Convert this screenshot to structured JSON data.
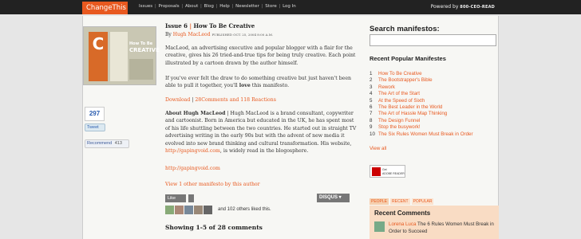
{
  "topbar": {
    "brand": "ChangeThis",
    "nav": [
      "Issues",
      "Proposals",
      "About",
      "Blog",
      "Help",
      "Newsletter",
      "Store",
      "Log In"
    ],
    "powered": "Powered by",
    "powered_brand": "800-CEO-READ"
  },
  "cover": {
    "letter": "C",
    "title_small": "How To Be",
    "title_big": "CREATIVE"
  },
  "social": {
    "count": "297",
    "tweet": "Tweet",
    "recommend": "Recommend",
    "recommend_count": "413"
  },
  "article": {
    "issue_label": "Issue 6",
    "title": "How To Be Creative",
    "by": "By",
    "author": "Hugh MacLeod",
    "published": "PUBLISHED OCT. 25, 2004 8:00 A.M.",
    "para1": "MacLeod, an advertising executive and popular blogger with a flair for the creative, gives his 26 tried-and-true tips for being truly creative. Each point illustrated by a cartoon drawn by the author himself.",
    "para2a": "If you've ever felt the draw to do something creative but just haven't been able to pull it together, you'll ",
    "para2b": "love",
    "para2c": " this manifesto.",
    "download": "Download",
    "comments_link": "28Comments and 118 Reactions",
    "about_label": "About Hugh MacLeod",
    "about_text": " | Hugh MacLeod is a brand consultant, copywriter and cartoonist. Born in America but educated in the UK, he has spent most of his life shuttling between the two countries. He started out in straight TV advertising writing in the early 90s but with the advent of new media it evolved into new brand thinking and cultural transformation. His website, ",
    "about_site": "http://gapingvoid.com",
    "about_tail": ", is widely read in the blogosphere.",
    "site_link": "http://gapingvoid.com",
    "view_other": "View 1 other manifesto by this author",
    "like": "Like",
    "disqus": "DISQUS",
    "liked": "and 102 others liked this.",
    "showing": "Showing 1-5 of 28 comments"
  },
  "sidebar": {
    "search_heading": "Search manifestos:",
    "search_placeholder": "",
    "recent_heading": "Recent Popular Manifestes",
    "manifestos": [
      "How To Be Creative",
      "The Bootstrapper's Bible",
      "Rework",
      "The Art of the Start",
      "At the Speed of Sixth",
      "The Best Leader in the World",
      "The Art of Hassle Map Thinking",
      "The Design Funnel",
      "Stop the busywork!",
      "The Six Rules Women Must Break in Order"
    ],
    "view_all": "View all",
    "reader_text1": "Get",
    "reader_text2": "ADOBE READER",
    "tabs": [
      "PEOPLE",
      "RECENT",
      "POPULAR"
    ],
    "recent_comments_heading": "Recent Comments",
    "comment_user": "Lorena Luca",
    "comment_text": " The 6 Rules Women Must Break in Order to Succeed"
  },
  "colors": {
    "accent": "#e8591f",
    "topbar": "#222222",
    "comments_bg": "#f9dcc4"
  }
}
